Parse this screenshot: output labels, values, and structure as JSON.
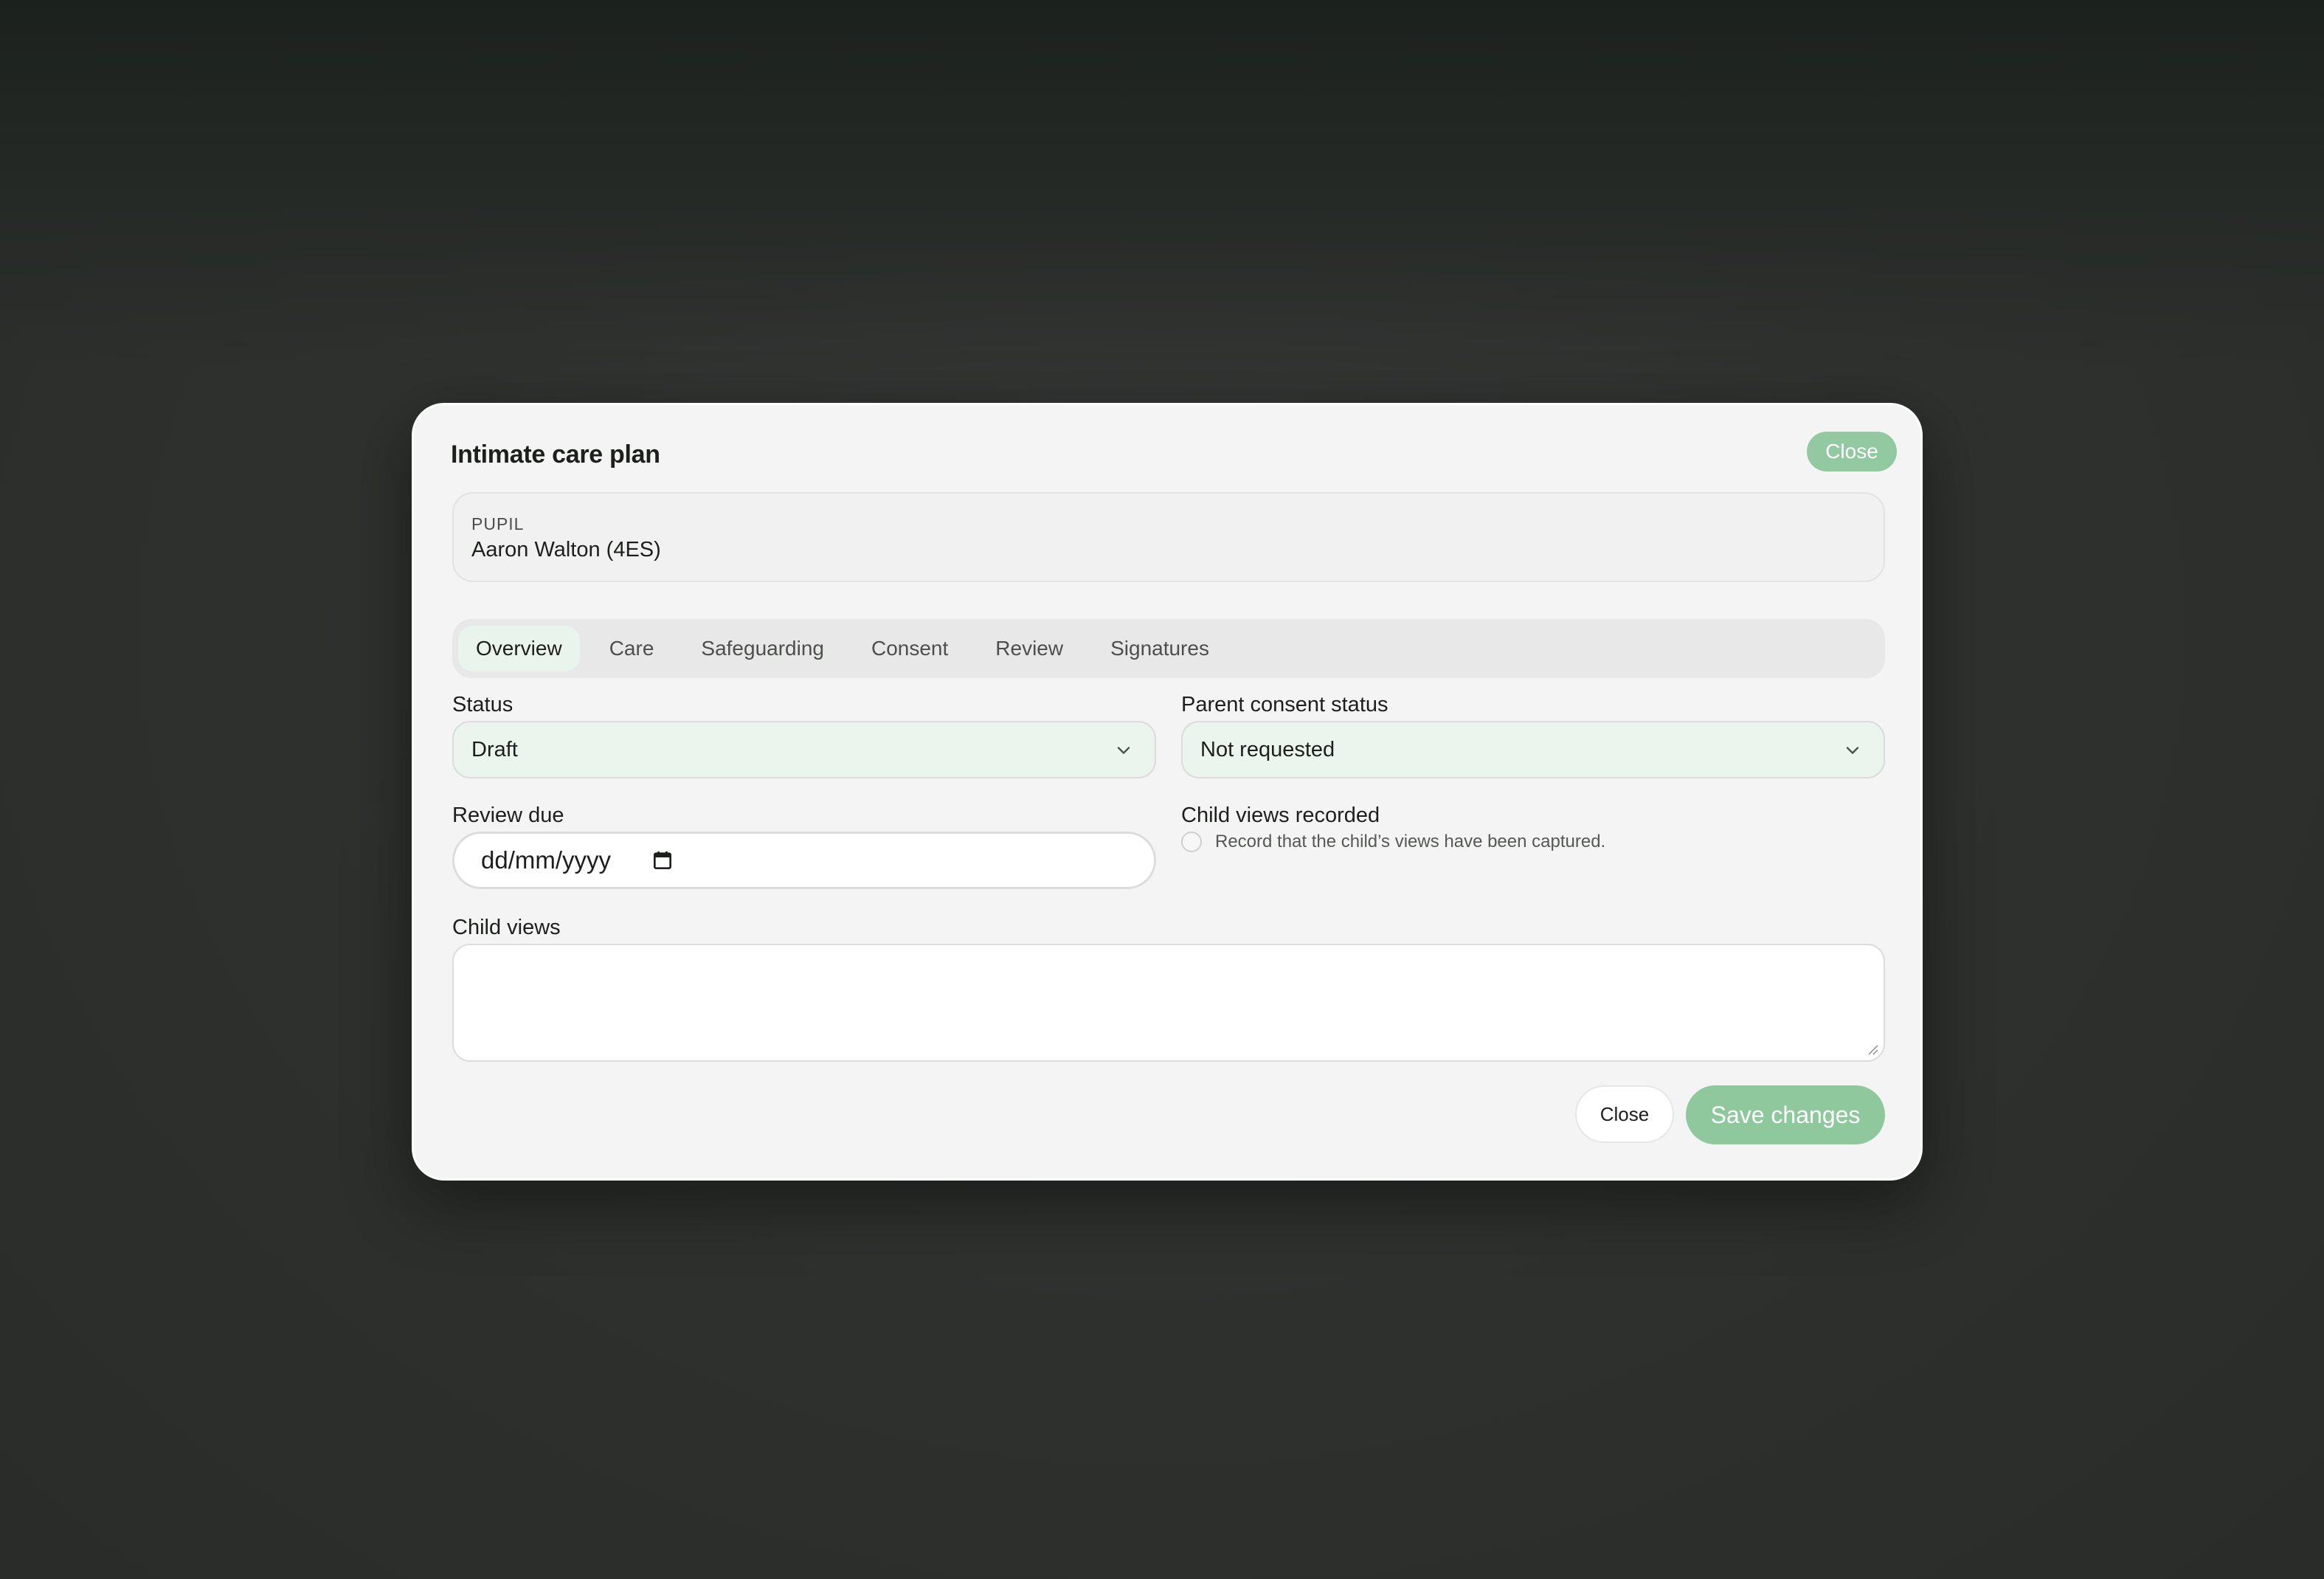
{
  "modal": {
    "title": "Intimate care plan",
    "close_top_label": "Close",
    "close_bottom_label": "Close",
    "save_label": "Save changes"
  },
  "pupil": {
    "label": "PUPIL",
    "value": "Aaron Walton (4ES)"
  },
  "tabs": [
    {
      "label": "Overview",
      "active": true
    },
    {
      "label": "Care",
      "active": false
    },
    {
      "label": "Safeguarding",
      "active": false
    },
    {
      "label": "Consent",
      "active": false
    },
    {
      "label": "Review",
      "active": false
    },
    {
      "label": "Signatures",
      "active": false
    }
  ],
  "form": {
    "status": {
      "label": "Status",
      "value": "Draft"
    },
    "parent_consent": {
      "label": "Parent consent status",
      "value": "Not requested"
    },
    "review_due": {
      "label": "Review due",
      "placeholder": "dd/mm/yyyy"
    },
    "child_views_recorded": {
      "label": "Child views recorded",
      "checkbox_text": "Record that the child’s views have been captured.",
      "checked": false
    },
    "child_views": {
      "label": "Child views",
      "value": ""
    }
  },
  "colors": {
    "accent": "#8fc89d",
    "select_bg": "#ebf4ed",
    "modal_bg": "#f4f4f4"
  },
  "icons": {
    "select_arrow": "chevron-down-icon",
    "date_picker": "calendar-icon",
    "textarea_resize": "resize-grip-icon"
  }
}
